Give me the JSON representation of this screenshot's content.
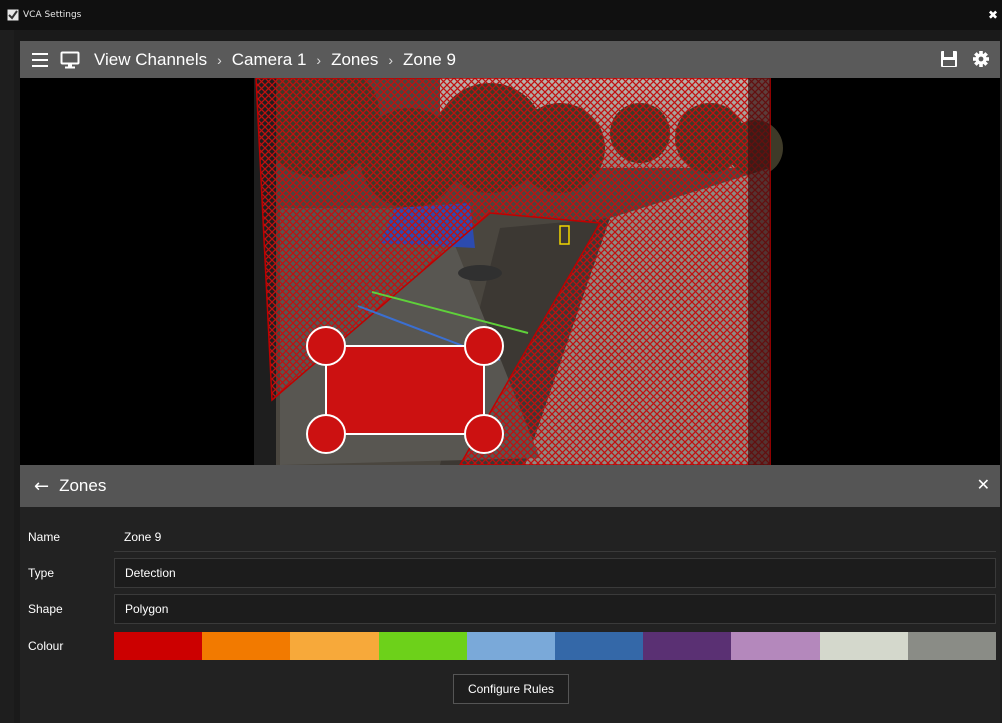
{
  "window": {
    "title": "VCA Settings",
    "close_glyph": "✖"
  },
  "header": {
    "breadcrumbs": [
      "View Channels",
      "Camera 1",
      "Zones",
      "Zone 9"
    ],
    "separator": "›",
    "icons": [
      "menu-icon",
      "monitor-icon",
      "save-icon",
      "gear-icon"
    ]
  },
  "video": {
    "zone_color": "#c00000",
    "handle_color": "#cc1111",
    "line_colors": [
      "#5fd13a",
      "#3b6fd1"
    ]
  },
  "zones_panel": {
    "title": "Zones",
    "back_glyph": "←",
    "close_glyph": "✕",
    "fields": {
      "name": {
        "label": "Name",
        "value": "Zone 9"
      },
      "type": {
        "label": "Type",
        "value": "Detection"
      },
      "shape": {
        "label": "Shape",
        "value": "Polygon"
      },
      "colour": {
        "label": "Colour"
      }
    },
    "colours": [
      "#cc0000",
      "#f27a00",
      "#f7a93a",
      "#6dd11a",
      "#7aa9d9",
      "#3468a8",
      "#5a3073",
      "#b488bc",
      "#d4d8cc",
      "#8a8c86"
    ],
    "configure_label": "Configure Rules"
  }
}
